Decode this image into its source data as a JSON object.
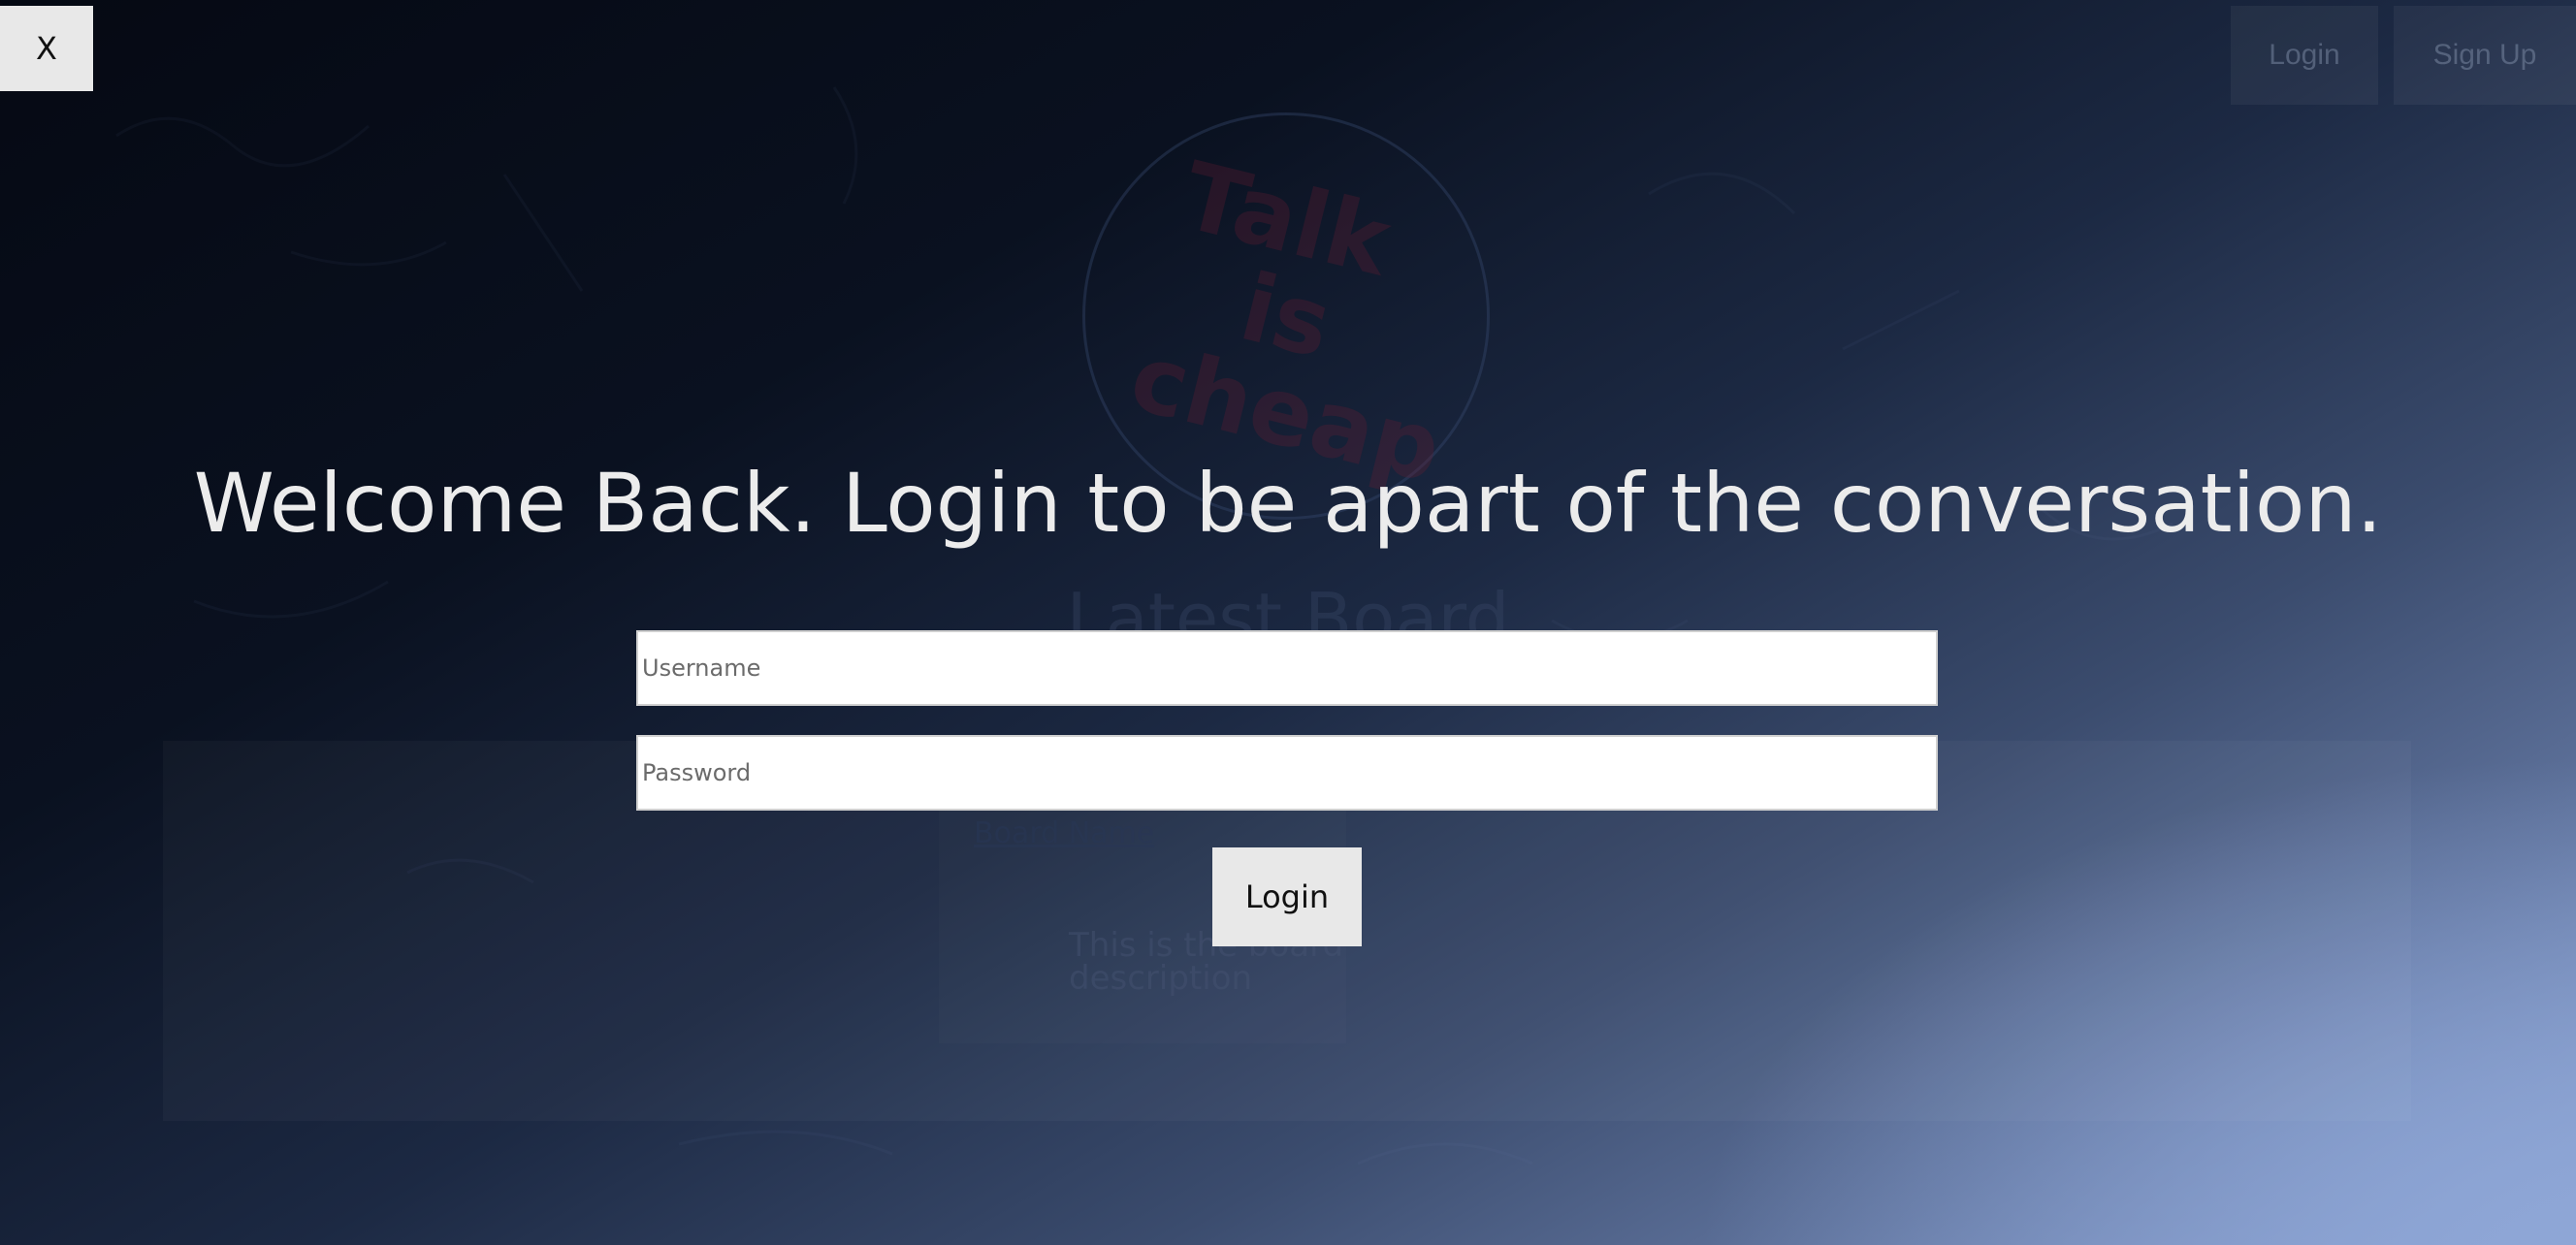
{
  "nav": {
    "login_label": "Login",
    "signup_label": "Sign Up"
  },
  "logo": {
    "lines": [
      "Talk",
      "is",
      "cheap"
    ]
  },
  "latest": {
    "title": "Latest Board",
    "board_name": "Board Name",
    "board_description": "This is the board description"
  },
  "modal": {
    "close_label": "X",
    "heading": "Welcome Back. Login to be apart of the conversation.",
    "username_placeholder": "Username",
    "password_placeholder": "Password",
    "submit_label": "Login"
  },
  "colors": {
    "background_dark": "#050913",
    "background_light": "#8fa7d8",
    "button_bg": "#e8e8e8",
    "heading_text": "#ececec"
  }
}
